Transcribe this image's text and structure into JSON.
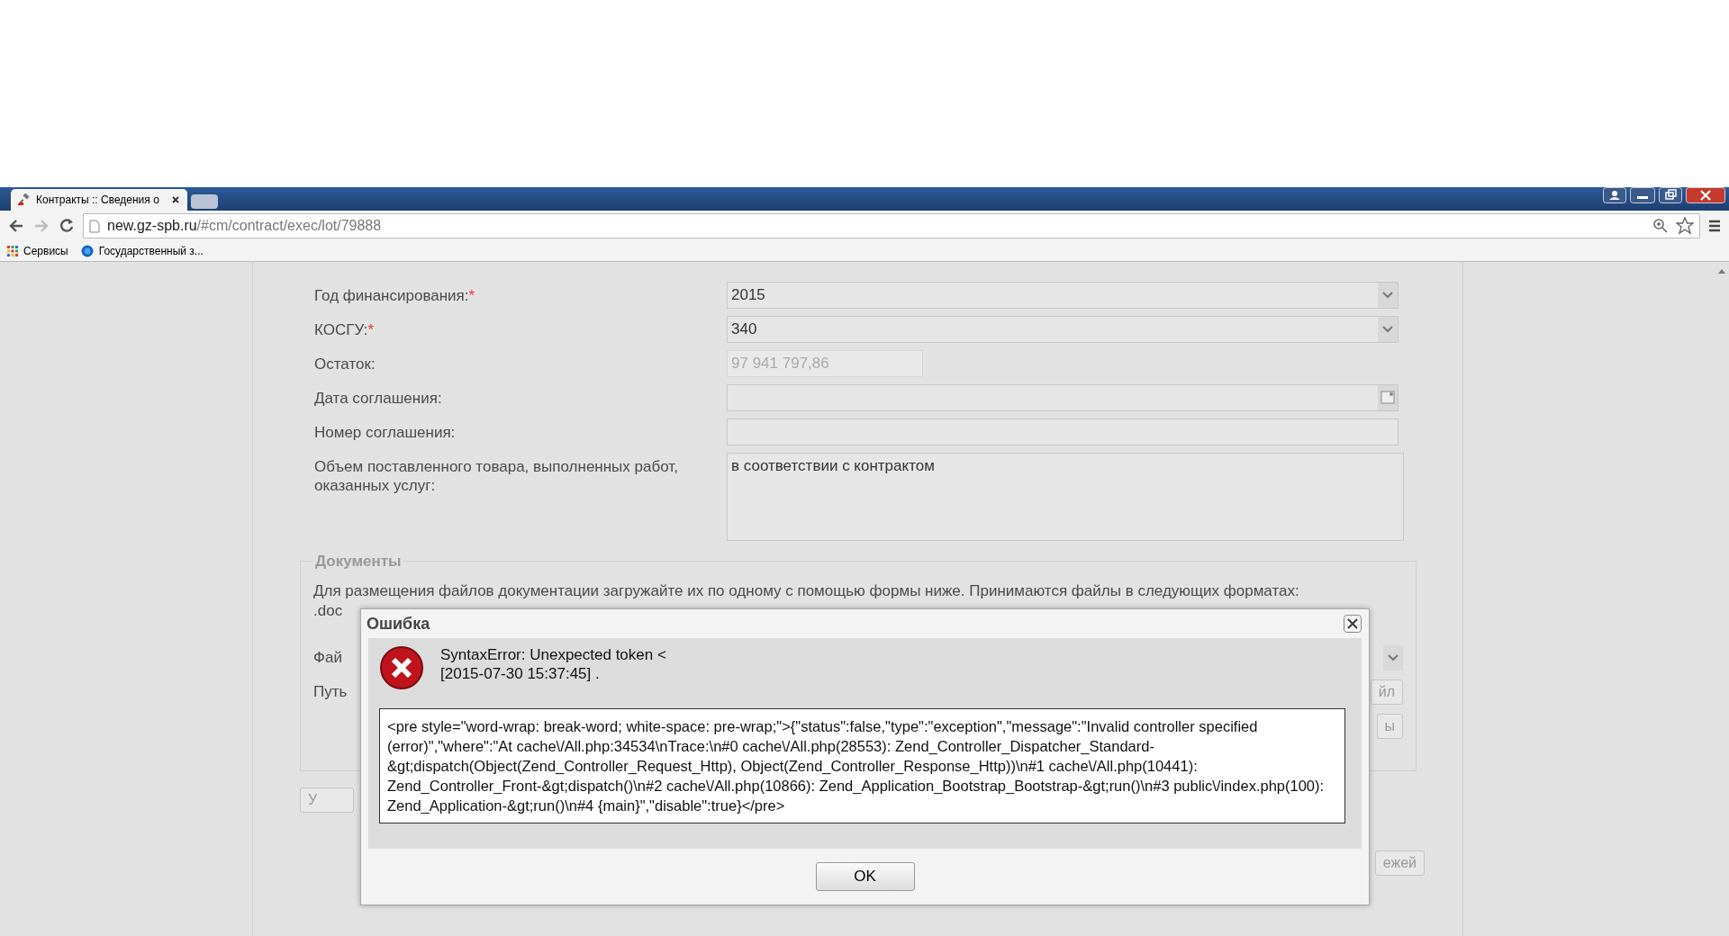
{
  "browser": {
    "tab": {
      "title": "Контракты :: Сведения о"
    },
    "url": {
      "host": "new.gz-spb.ru",
      "path": "/#cm/contract/exec/lot/79888"
    },
    "bookmarks": [
      {
        "label": "Сервисы",
        "kind": "apps"
      },
      {
        "label": "Государственный з...",
        "kind": "site"
      }
    ]
  },
  "form": {
    "required_mark": "*",
    "fields": [
      {
        "label": "Год финансирования:",
        "required": true,
        "kind": "select",
        "value": "2015",
        "disabled": false
      },
      {
        "label": "КОСГУ:",
        "required": true,
        "kind": "select",
        "value": "340",
        "disabled": false
      },
      {
        "label": "Остаток:",
        "required": false,
        "kind": "short",
        "value": "97 941 797,86",
        "disabled": true
      },
      {
        "label": "Дата соглашения:",
        "required": false,
        "kind": "date",
        "disabled": false
      },
      {
        "label": "Номер соглашения:",
        "required": false,
        "kind": "text",
        "disabled": false
      },
      {
        "label": "Объем поставленного товара, выполненных работ, оказанных услуг:",
        "required": false,
        "kind": "textarea",
        "value": "в соответствии с контрактом",
        "disabled": false
      }
    ]
  },
  "documents": {
    "legend": "Документы",
    "text": "Для размещения файлов документации загружайте их по одному с помощью формы ниже. Принимаются файлы в следующих форматах:",
    "text_2": ".doc",
    "label_1": "Фай",
    "label_2": "Путь",
    "button_1": "йл",
    "button_2": "ы"
  },
  "button_below": "У",
  "button_bottom": "ежей",
  "dialog": {
    "title": "Ошибка",
    "message": [
      "SyntaxError: Unexpected token <",
      "[2015-07-30 15:37:45] ."
    ],
    "detail": "<pre style=\"word-wrap: break-word; white-space: pre-wrap;\">{\"status\":false,\"type\":\"exception\",\"message\":\"Invalid controller specified (error)\",\"where\":\"At cache\\/All.php:34534\\nTrace:\\n#0 cache\\/All.php(28553): Zend_Controller_Dispatcher_Standard-&gt;dispatch(Object(Zend_Controller_Request_Http), Object(Zend_Controller_Response_Http))\\n#1 cache\\/All.php(10441): Zend_Controller_Front-&gt;dispatch()\\n#2 cache\\/All.php(10866): Zend_Application_Bootstrap_Bootstrap-&gt;run()\\n#3 public\\/index.php(100): Zend_Application-&gt;run()\\n#4 {main}\",\"disable\":true}</pre>",
    "button": "OK"
  }
}
